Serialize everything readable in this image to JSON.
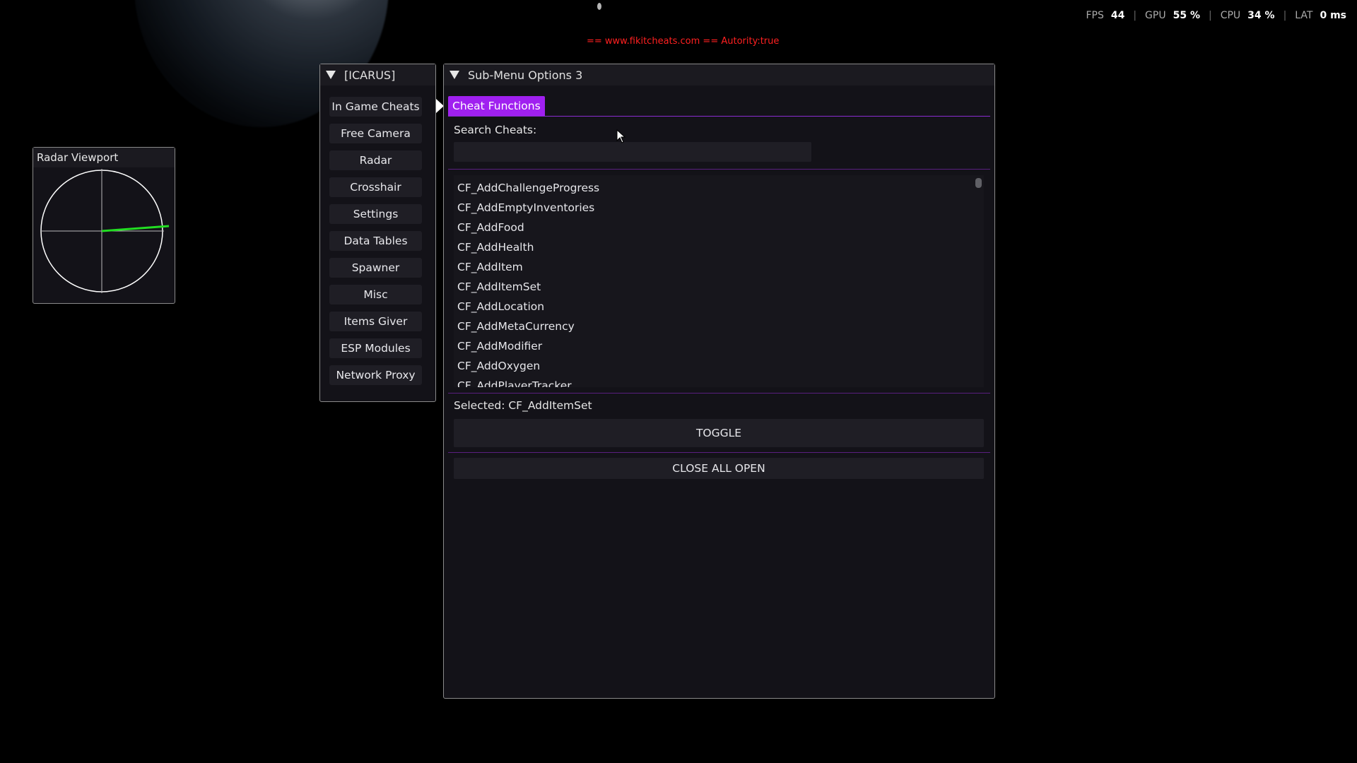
{
  "perf": {
    "fps_label": "FPS",
    "fps_value": "44",
    "gpu_label": "GPU",
    "gpu_value": "55 %",
    "cpu_label": "CPU",
    "cpu_value": "34 %",
    "lat_label": "LAT",
    "lat_value": "0 ms"
  },
  "banner": "== www.fikitcheats.com == Autority:true",
  "radar": {
    "title": "Radar Viewport",
    "line_color": "#22dd22"
  },
  "menu": {
    "title": "[ICARUS]",
    "items": [
      "In Game Cheats",
      "Free Camera",
      "Radar",
      "Crosshair",
      "Settings",
      "Data Tables",
      "Spawner",
      "Misc",
      "Items Giver",
      "ESP Modules",
      "Network Proxy"
    ]
  },
  "main": {
    "title": "Sub-Menu Options 3",
    "tab_label": "Cheat Functions",
    "search_label": "Search Cheats:",
    "search_value": "",
    "list_items": [
      "CF_AddChallengeProgress",
      "CF_AddEmptyInventories",
      "CF_AddFood",
      "CF_AddHealth",
      "CF_AddItem",
      "CF_AddItemSet",
      "CF_AddLocation",
      "CF_AddMetaCurrency",
      "CF_AddModifier",
      "CF_AddOxygen",
      "CF_AddPlayerTracker"
    ],
    "selected_text": "Selected: CF_AddItemSet",
    "toggle_label": "TOGGLE",
    "close_label": "CLOSE ALL OPEN"
  },
  "colors": {
    "accent": "#a020f0",
    "banner": "#ff2020",
    "window_bg": "#131218"
  }
}
